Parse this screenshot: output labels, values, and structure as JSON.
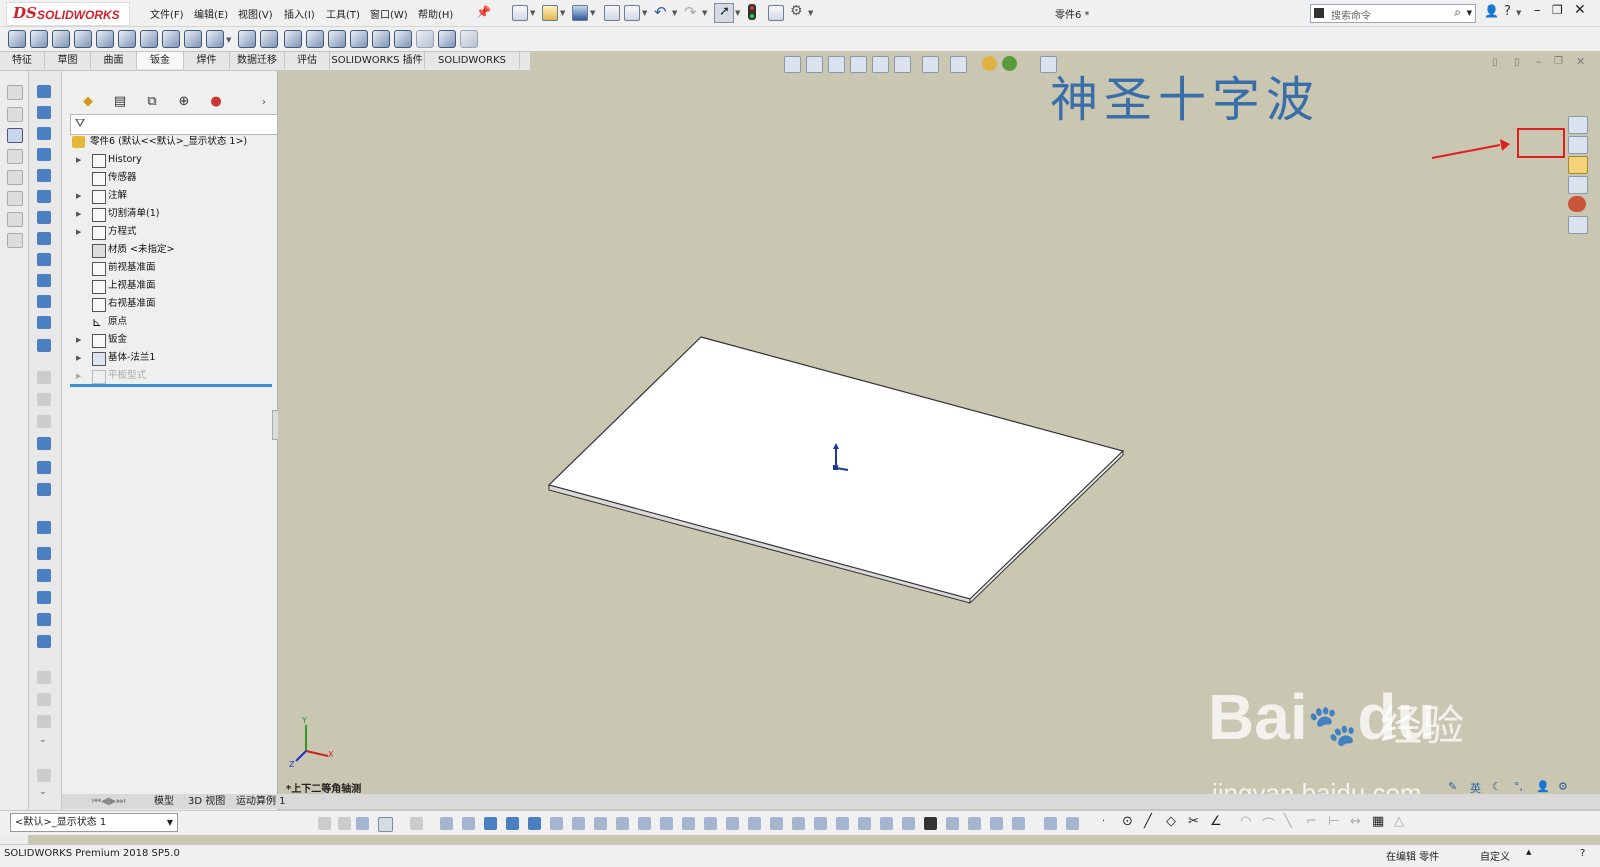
{
  "app": {
    "logo_ds": "DS",
    "logo_text": "SOLIDWORKS",
    "document_title": "零件6 *"
  },
  "menu": [
    "文件(F)",
    "编辑(E)",
    "视图(V)",
    "插入(I)",
    "工具(T)",
    "窗口(W)",
    "帮助(H)"
  ],
  "search": {
    "placeholder": "搜索命令"
  },
  "command_tabs": [
    "特征",
    "草图",
    "曲面",
    "钣金",
    "焊件",
    "数据迁移",
    "评估",
    "SOLIDWORKS 插件",
    "SOLIDWORKS MBD"
  ],
  "active_command_tab": "钣金",
  "feature_tree": {
    "root": "零件6  (默认<<默认>_显示状态 1>)",
    "items": [
      {
        "label": "History",
        "expandable": true
      },
      {
        "label": "传感器",
        "expandable": false
      },
      {
        "label": "注解",
        "expandable": true
      },
      {
        "label": "切割清单(1)",
        "expandable": true
      },
      {
        "label": "方程式",
        "expandable": true
      },
      {
        "label": "材质 <未指定>",
        "expandable": false
      },
      {
        "label": "前视基准面",
        "expandable": false
      },
      {
        "label": "上视基准面",
        "expandable": false
      },
      {
        "label": "右视基准面",
        "expandable": false
      },
      {
        "label": "原点",
        "expandable": false
      },
      {
        "label": "钣金",
        "expandable": true
      },
      {
        "label": "基体-法兰1",
        "expandable": true
      },
      {
        "label": "平板型式",
        "expandable": true
      }
    ]
  },
  "graphics": {
    "watermark": "神圣十字波",
    "view_name": "*上下二等角轴测",
    "triad": {
      "x": "X",
      "y": "Y",
      "z": "Z"
    }
  },
  "baidu": {
    "brand": "Bai",
    "du": "du",
    "jingyan": "经验",
    "url": "jingyan.baidu.com"
  },
  "bottom_tabs": [
    "模型",
    "3D 视图",
    "运动算例 1"
  ],
  "configuration": "<默认>_显示状态 1",
  "status": {
    "product": "SOLIDWORKS Premium 2018 SP5.0",
    "editing": "在编辑 零件",
    "custom": "自定义"
  },
  "colors": {
    "accent": "#d4202a",
    "viewport": "#c9c7b1",
    "selection_blue": "#3b8fd6",
    "annotation_red": "#e0201e",
    "watermark_blue": "#3a6ea8"
  }
}
